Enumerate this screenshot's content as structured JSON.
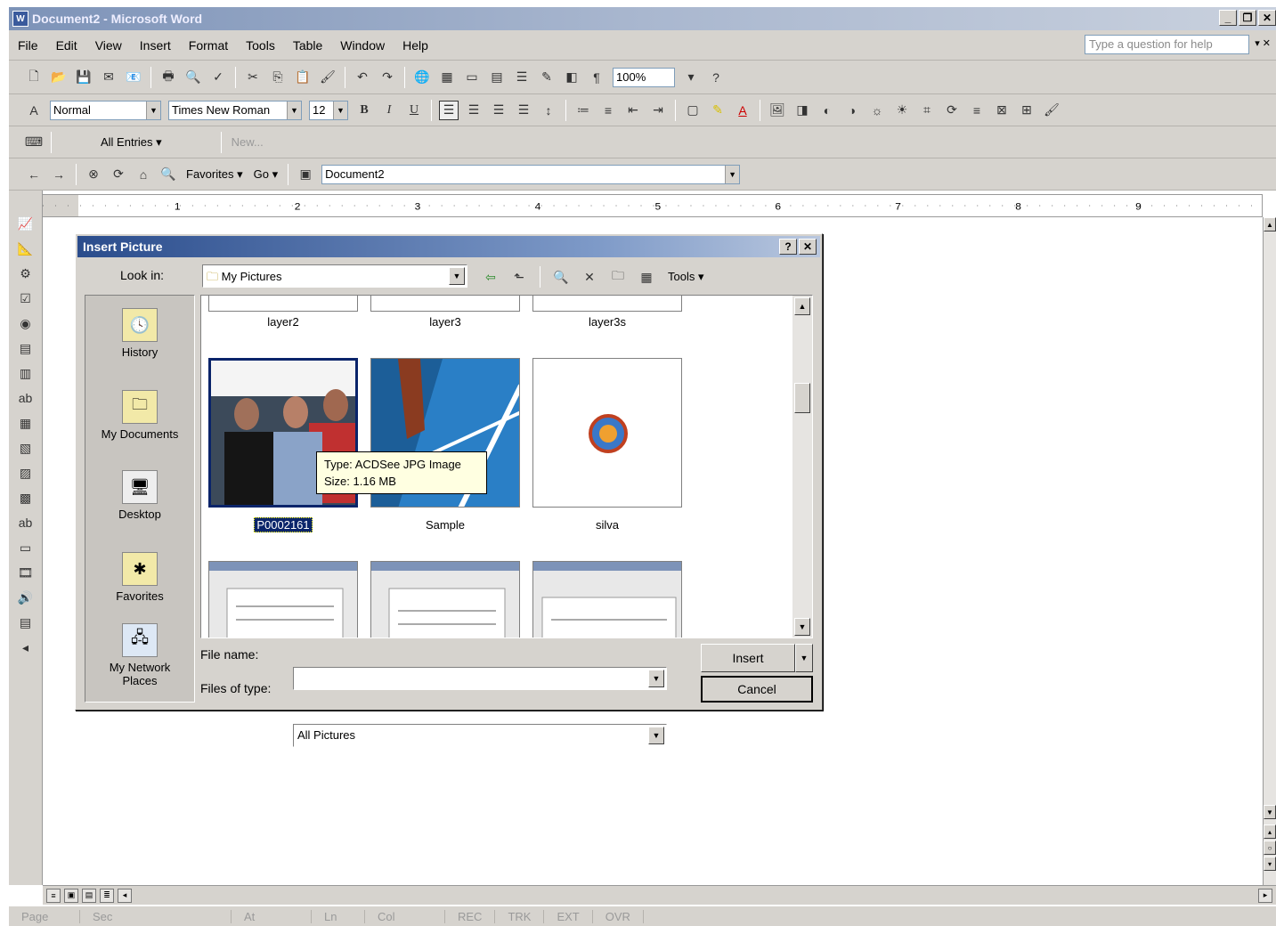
{
  "window": {
    "title": "Document2 - Microsoft Word",
    "app_icon": "W"
  },
  "menubar": {
    "items": [
      "File",
      "Edit",
      "View",
      "Insert",
      "Format",
      "Tools",
      "Table",
      "Window",
      "Help"
    ],
    "help_placeholder": "Type a question for help"
  },
  "toolbar_standard": {
    "zoom": "100%"
  },
  "toolbar_formatting": {
    "style": "Normal",
    "font": "Times New Roman",
    "size": "12"
  },
  "toolbar_autotext": {
    "all_entries": "All Entries ▾",
    "new": "New..."
  },
  "toolbar_web": {
    "favorites": "Favorites ▾",
    "go": "Go ▾",
    "address": "Document2"
  },
  "ruler": {
    "marks": [
      "1",
      "2",
      "3",
      "4",
      "5",
      "6",
      "7",
      "8",
      "9"
    ]
  },
  "statusbar": {
    "items": [
      "Page",
      "Sec",
      "At",
      "Ln",
      "Col",
      "REC",
      "TRK",
      "EXT",
      "OVR"
    ]
  },
  "dialog": {
    "title": "Insert Picture",
    "look_in_label": "Look in:",
    "look_in_value": "My Pictures",
    "tools_label": "Tools ▾",
    "places": [
      "History",
      "My Documents",
      "Desktop",
      "Favorites",
      "My Network Places"
    ],
    "top_row_captions": [
      "layer2",
      "layer3",
      "layer3s"
    ],
    "middle_row_captions": [
      "P0002161",
      "Sample",
      "silva"
    ],
    "tooltip": {
      "type": "Type: ACDSee JPG Image",
      "size": "Size: 1.16 MB"
    },
    "file_name_label": "File name:",
    "file_name_value": "",
    "files_of_type_label": "Files of type:",
    "files_of_type_value": "All Pictures",
    "insert_label": "Insert",
    "cancel_label": "Cancel"
  }
}
